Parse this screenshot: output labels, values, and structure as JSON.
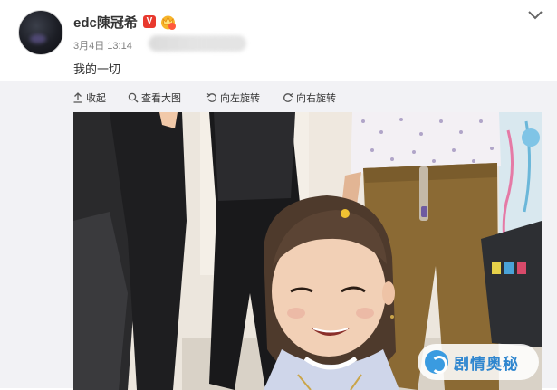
{
  "post": {
    "username": "edc陳冠希",
    "verified_badge": "V",
    "timestamp": "3月4日 13:14",
    "text": "我的一切"
  },
  "toolbar": {
    "collapse_label": "收起",
    "view_large_label": "查看大图",
    "rotate_left_label": "向左旋转",
    "rotate_right_label": "向右旋转"
  },
  "watermark": {
    "text": "剧情奥秘"
  },
  "icons": {
    "collapse": "arrow-up-icon",
    "view_large": "magnifier-icon",
    "rotate_left": "rotate-left-icon",
    "rotate_right": "rotate-right-icon",
    "menu": "chevron-down-icon"
  },
  "colors": {
    "verified_badge": "#e8392e",
    "toolbar_bg": "#f2f2f5",
    "watermark_text": "#2f86cf"
  }
}
